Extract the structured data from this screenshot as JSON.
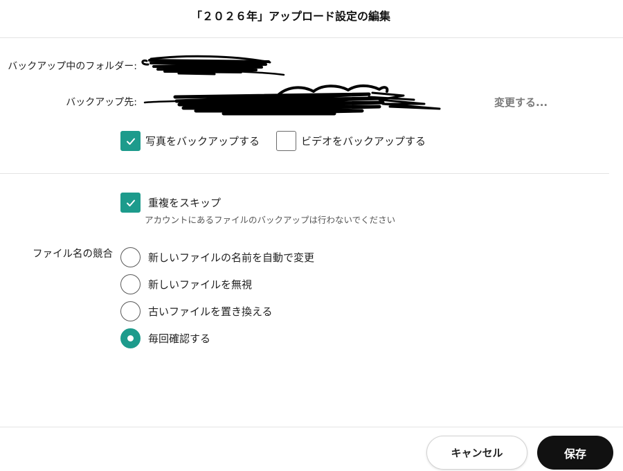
{
  "dialog": {
    "title": "「２０２６年」アップロード設定の編集"
  },
  "backup": {
    "folder_label": "バックアップ中のフォルダー:",
    "destination_label": "バックアップ先:",
    "change_link": "変更する..."
  },
  "media": {
    "photos": {
      "label": "写真をバックアップする",
      "checked": true
    },
    "videos": {
      "label": "ビデオをバックアップする",
      "checked": false
    }
  },
  "duplicates": {
    "label": "重複をスキップ",
    "checked": true,
    "hint": "アカウントにあるファイルのバックアップは行わないでください"
  },
  "conflict": {
    "label": "ファイル名の競合",
    "options": [
      {
        "label": "新しいファイルの名前を自動で変更",
        "selected": false
      },
      {
        "label": "新しいファイルを無視",
        "selected": false
      },
      {
        "label": "古いファイルを置き換える",
        "selected": false
      },
      {
        "label": "毎回確認する",
        "selected": true
      }
    ]
  },
  "actions": {
    "cancel_label": "キャンセル",
    "save_label": "保存"
  },
  "colors": {
    "accent": "#1d9b8c",
    "save_button": "#111111",
    "link_text": "#7a7a7a"
  },
  "icons": {
    "checkbox_checked": "checkmark-icon",
    "radio_selected": "radio-dot-icon"
  }
}
